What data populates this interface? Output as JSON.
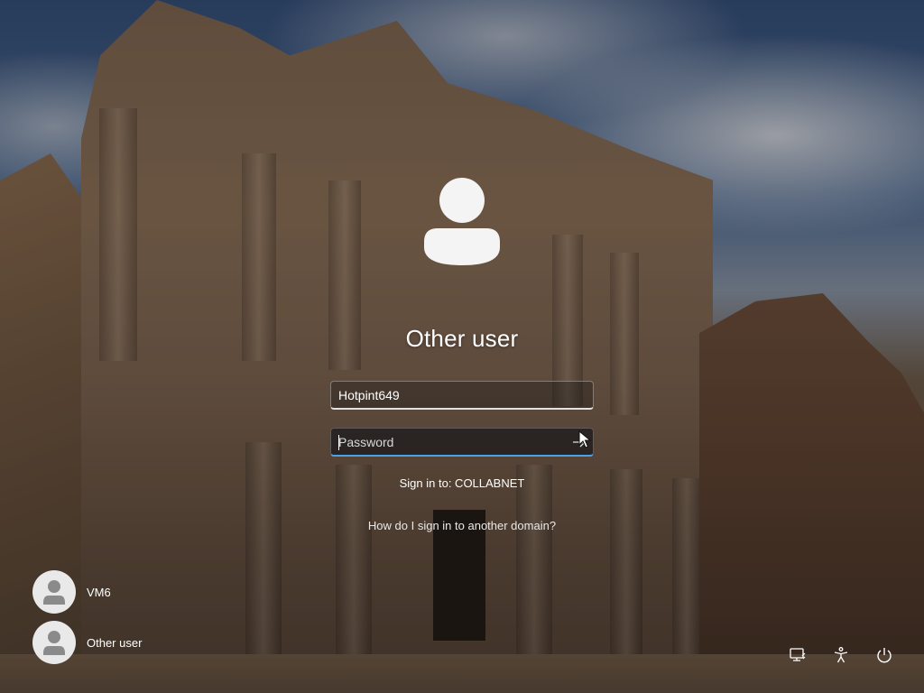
{
  "login": {
    "title": "Other user",
    "username_value": "Hotpint649",
    "password_placeholder": "Password",
    "sign_in_to": "Sign in to: COLLABNET",
    "other_domain_link": "How do I sign in to another domain?"
  },
  "users": [
    {
      "name": "VM6",
      "icon": "user-avatar-icon"
    },
    {
      "name": "Other user",
      "icon": "user-avatar-icon"
    }
  ],
  "tray": {
    "icons": [
      "network-icon",
      "accessibility-icon",
      "power-icon"
    ]
  },
  "colors": {
    "focus_accent": "#4aa3e8",
    "text": "#ffffff"
  }
}
